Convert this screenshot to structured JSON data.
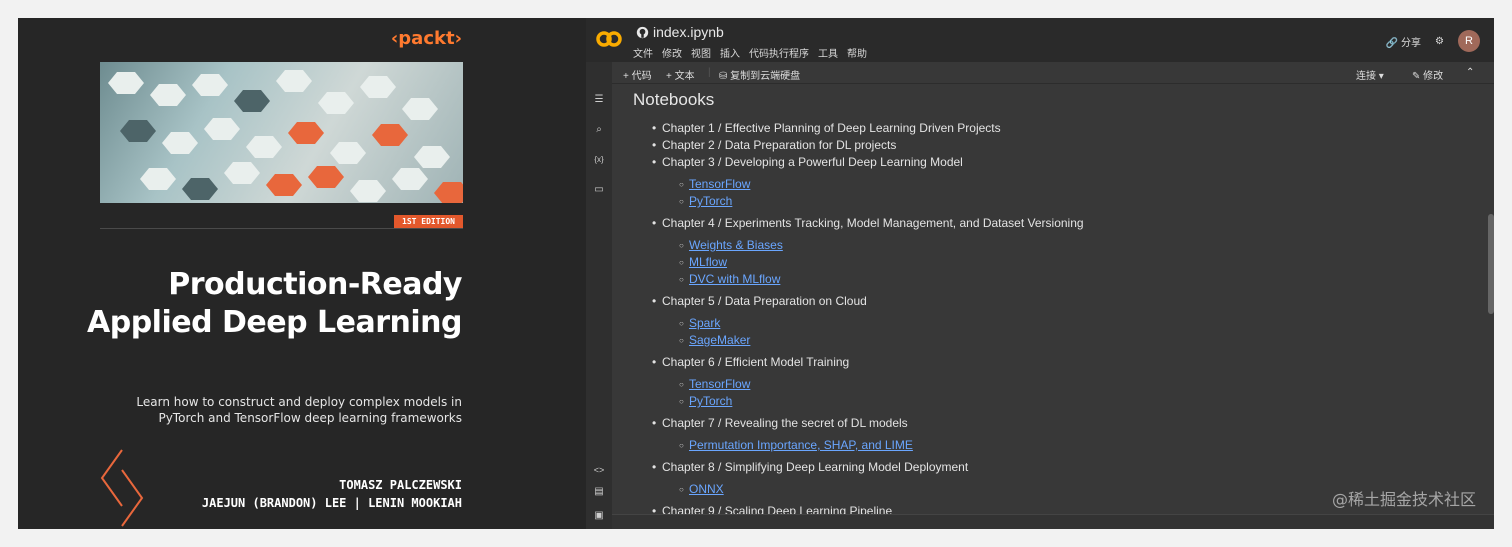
{
  "cover": {
    "publisher": "‹packt›",
    "edition": "1ST EDITION",
    "title_line1": "Production-Ready",
    "title_line2": "Applied Deep Learning",
    "subtitle_line1": "Learn how to construct and deploy complex models in",
    "subtitle_line2": "PyTorch and TensorFlow deep learning frameworks",
    "author_line1": "TOMASZ PALCZEWSKI",
    "author_line2": "JAEJUN (BRANDON) LEE | LENIN MOOKIAH",
    "accent_color": "#ff7a2f"
  },
  "colab": {
    "notebook_name": "index.ipynb",
    "menu": [
      "文件",
      "修改",
      "视图",
      "插入",
      "代码执行程序",
      "工具",
      "帮助"
    ],
    "share_label": "分享",
    "avatar_initial": "R",
    "toolbar": {
      "add_code": "+ 代码",
      "add_text": "+ 文本",
      "copy_drive": "复制到云端硬盘",
      "connect": "连接",
      "edit": "修改"
    },
    "heading": "Notebooks",
    "chapters": [
      {
        "label": "Chapter 1 / Effective Planning of Deep Learning Driven Projects",
        "links": []
      },
      {
        "label": "Chapter 2 / Data Preparation for DL projects",
        "links": []
      },
      {
        "label": "Chapter 3 / Developing a Powerful Deep Learning Model",
        "links": [
          "TensorFlow",
          "PyTorch"
        ]
      },
      {
        "label": "Chapter 4 / Experiments Tracking, Model Management, and Dataset Versioning",
        "links": [
          "Weights & Biases",
          "MLflow",
          "DVC with MLflow"
        ]
      },
      {
        "label": "Chapter 5 / Data Preparation on Cloud",
        "links": [
          "Spark",
          "SageMaker"
        ]
      },
      {
        "label": "Chapter 6 / Efficient Model Training",
        "links": [
          "TensorFlow",
          "PyTorch"
        ]
      },
      {
        "label": "Chapter 7 / Revealing the secret of DL models",
        "links": [
          "Permutation Importance, SHAP, and LIME"
        ]
      },
      {
        "label": "Chapter 8 / Simplifying Deep Learning Model Deployment",
        "links": [
          "ONNX"
        ]
      },
      {
        "label": "Chapter 9 / Scaling Deep Learning Pipeline",
        "links": []
      }
    ]
  },
  "watermark": "@稀土掘金技术社区"
}
